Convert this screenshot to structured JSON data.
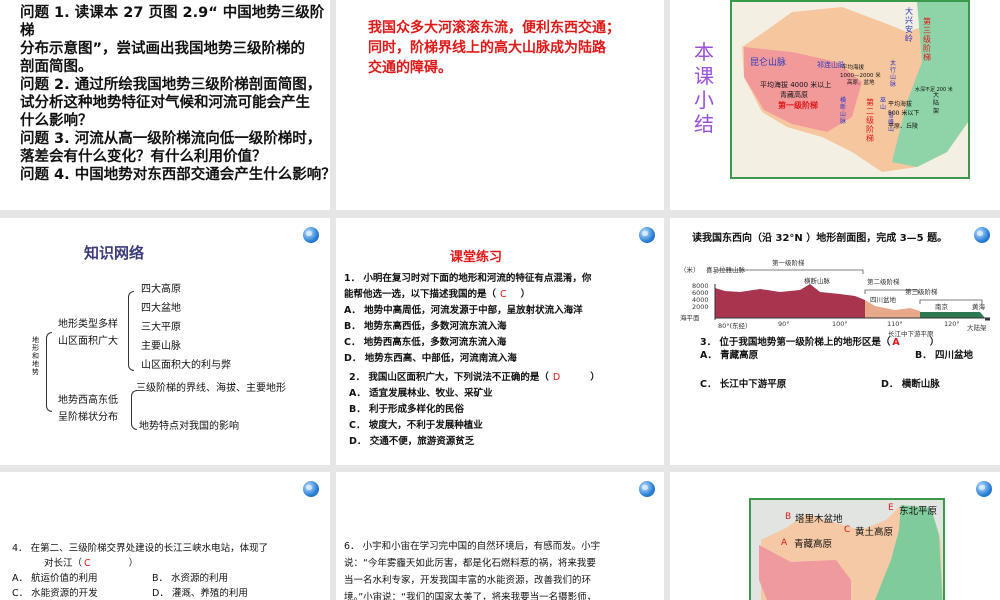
{
  "slide1": {
    "lines": [
      "问题 1. 读课本 27 页图 2.9“ 中国地势三级阶梯",
      "分布示意图”，尝试画出我国地势三级阶梯的",
      "剖面简图。",
      "问题 2. 通过所绘我国地势三级阶梯剖面简图，",
      "试分析这种地势特征对气候和河流可能会产生",
      "什么影响？",
      "问题 3. 河流从高一级阶梯流向低一级阶梯时，",
      "落差会有什么变化？有什么利用价值？",
      "问题 4. 中国地势对东西部交通会产生什么影响？"
    ]
  },
  "slide2": {
    "lines": [
      "我国众多大河滚滚东流，便利东西交通；",
      "同时，阶梯界线上的高大山脉成为陆路",
      "交通的障碍。"
    ]
  },
  "slide3": {
    "side_title": "本课小结",
    "labels": {
      "kunlun": "昆仑山脉",
      "qilian": "祁连山脉",
      "daxinganling": "大兴安岭",
      "taihang": "太行山脉",
      "hengduan": "横断山脉",
      "wushan": "巫山",
      "xuefeng": "雪峰山",
      "step1_desc": "平均海拔 4000 米以上",
      "qingzang": "青藏高原",
      "step1": "第一级阶梯",
      "step2_desc": "平均海拔",
      "step2_range": "1000—2000 米",
      "step2_types": "高原、盆地",
      "step2": "第二级阶梯",
      "step3": "第三级阶梯",
      "step3_desc": "平均海拔",
      "step3_range": "500 米以下",
      "step3_types": "平原、丘陵",
      "shelf_depth": "水深不足 200 米",
      "shelf": "大陆架"
    }
  },
  "slide4": {
    "title": "知识网络",
    "root": "地形和地势",
    "branch1": [
      "地形类型多样",
      "山区面积广大"
    ],
    "branch1_items": [
      "四大高原",
      "四大盆地",
      "三大平原",
      "主要山脉",
      "山区面积大的利与弊"
    ],
    "branch2": [
      "地势西高东低",
      "呈阶梯状分布"
    ],
    "branch2_items": [
      "三级阶梯的界线、海拔、主要地形",
      "地势特点对我国的影响"
    ]
  },
  "slide5": {
    "title": "课堂练习",
    "q1": [
      "1． 小明在复习时对下面的地形和河流的特征有点混淆，你",
      "能帮他选一选，以下描述我国的是（"
    ],
    "q1_close": "）",
    "q1_answer": "C",
    "q1_options": [
      "A． 地势中高周低，河流发源于中部，呈放射状流入海洋",
      "B． 地势东高西低，多数河流东流入海",
      "C． 地势西高东低，多数河流东流入海",
      "D． 地势东西高、中部低，河流南流入海"
    ],
    "q2": "2． 我国山区面积广大，下列说法不正确的是（",
    "q2_close": "）",
    "q2_answer": "D",
    "q2_options": [
      "A． 适宜发展林业、牧业、采矿业",
      "B． 利于形成多样化的民俗",
      "C． 坡度大，不利于发展种植业",
      "D． 交通不便，旅游资源贫乏"
    ]
  },
  "slide6": {
    "header": "读我国东西向（沿 32°N ）地形剖面图，完成 3—5 题。",
    "profile": {
      "unit": "（米）",
      "himalaya": "喜马拉雅山脉",
      "y_ticks": [
        "8000",
        "6000",
        "4000",
        "2000"
      ],
      "sea_level": "海平面",
      "x_ticks": [
        "80°(东经）",
        "90°",
        "100°",
        "110°",
        "120°"
      ],
      "step1": "第一级阶梯",
      "step2": "第二级阶梯",
      "step3": "第三级阶梯",
      "qingzang": "青藏高原",
      "hengduan": "横断山脉",
      "sichuan": "四川盆地",
      "nanjing": "南京",
      "changjiang": "长江中下游平原",
      "huanghai": "黄海",
      "shelf": "大陆架"
    },
    "q3": "3． 位于我国地势第一级阶梯上的地形区是（",
    "q3_close": "）",
    "q3_answer": "A",
    "q3_options": [
      "A． 青藏高原",
      "B． 四川盆地",
      "C． 长江中下游平原",
      "D． 横断山脉"
    ]
  },
  "slide7": {
    "q4": [
      "4． 在第二、三级阶梯交界处建设的长江三峡水电站，体现了",
      "对长江（"
    ],
    "q4_close": "）",
    "q4_answer": "C",
    "q4_options": [
      "A． 航运价值的利用",
      "B． 水资源的利用",
      "C． 水能资源的开发",
      "D． 灌溉、养殖的利用"
    ]
  },
  "slide8": {
    "lines": [
      "6． 小宇和小宙在学习完中国的自然环境后，有感而发。小宇",
      "说：“今年雾霾天如此厉害，都是化石燃料惹的祸，将来我要",
      "当一名水利专家，开发我国丰富的水能资源，改善我们的环",
      "境。”小宙说：“我们的国家太美了，将来我要当一名摄影师，"
    ]
  },
  "slide9": {
    "labels": [
      {
        "letter": "B",
        "name": "塔里木盆地"
      },
      {
        "letter": "C",
        "name": "黄土高原"
      },
      {
        "letter": "E",
        "name": "东北平原"
      },
      {
        "letter": "A",
        "name": "青藏高原"
      }
    ]
  }
}
